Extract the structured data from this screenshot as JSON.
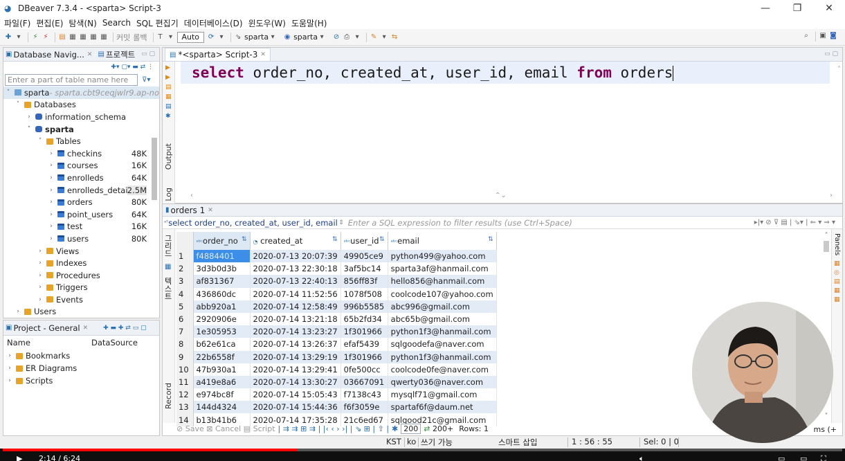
{
  "window": {
    "title": "DBeaver 7.3.4 - <sparta> Script-3",
    "controls": [
      "—",
      "❐",
      "✕"
    ]
  },
  "menu": [
    "파일(F)",
    "편집(E)",
    "탐색(N)",
    "Search",
    "SQL 편집기",
    "데이터베이스(D)",
    "윈도우(W)",
    "도움말(H)"
  ],
  "toolbar": {
    "commit_label": "커밋",
    "rollback_label": "롤백",
    "auto_label": "Auto",
    "datasource": "sparta",
    "schema": "sparta"
  },
  "navigator": {
    "tab_label": "Database Navig...",
    "tab2_label": "프로젝트",
    "filter_placeholder": "Enter a part of table name here",
    "connection": "sparta",
    "connection_host": " - sparta.cbt9ceqjwlr9.ap-no",
    "databases_label": "Databases",
    "info_schema": "information_schema",
    "db_name": "sparta",
    "tables_label": "Tables",
    "tables": [
      {
        "name": "checkins",
        "size": "48K"
      },
      {
        "name": "courses",
        "size": "16K"
      },
      {
        "name": "enrolleds",
        "size": "64K"
      },
      {
        "name": "enrolleds_detail",
        "size": "2.5M"
      },
      {
        "name": "orders",
        "size": "80K"
      },
      {
        "name": "point_users",
        "size": "64K"
      },
      {
        "name": "test",
        "size": "16K"
      },
      {
        "name": "users",
        "size": "80K"
      }
    ],
    "folders": [
      "Views",
      "Indexes",
      "Procedures",
      "Triggers",
      "Events"
    ],
    "users_label": "Users"
  },
  "project": {
    "tab_label": "Project - General",
    "col_name": "Name",
    "col_datasource": "DataSource",
    "items": [
      "Bookmarks",
      "ER Diagrams",
      "Scripts"
    ]
  },
  "editor": {
    "tab_label": "*<sparta> Script-3",
    "output_label": "Output",
    "log_label": "Log",
    "code": {
      "kw1": "select",
      "cols": " order_no, created_at, user_id, email ",
      "kw2": "from",
      "table": " orders"
    }
  },
  "results": {
    "tab_label": "orders 1",
    "query_text": "select order_no, created_at, user_id, email fro",
    "filter_placeholder": "Enter a SQL expression to filter results (use Ctrl+Space)",
    "headers": [
      "order_no",
      "created_at",
      "user_id",
      "email"
    ],
    "rows": [
      [
        "1",
        "f4884401",
        "2020-07-13 20:07:39",
        "49905ce9",
        "python499@yahoo.com"
      ],
      [
        "2",
        "3d3b0d3b",
        "2020-07-13 22:30:18",
        "3af5bc14",
        "sparta3af@hanmail.com"
      ],
      [
        "3",
        "af831367",
        "2020-07-13 22:40:13",
        "856ff83f",
        "hello856@hanmail.com"
      ],
      [
        "4",
        "436860dc",
        "2020-07-14 11:52:56",
        "1078f508",
        "coolcode107@yahoo.com"
      ],
      [
        "5",
        "abb920a1",
        "2020-07-14 12:58:49",
        "996b5585",
        "abc996@gmail.com"
      ],
      [
        "6",
        "2920906e",
        "2020-07-14 13:21:18",
        "65b2fd34",
        "abc65b@gmail.com"
      ],
      [
        "7",
        "1e305953",
        "2020-07-14 13:23:27",
        "1f301966",
        "python1f3@hanmail.com"
      ],
      [
        "8",
        "b62e61ca",
        "2020-07-14 13:26:37",
        "efaf5439",
        "sqlgoodefa@naver.com"
      ],
      [
        "9",
        "22b6558f",
        "2020-07-14 13:29:19",
        "1f301966",
        "python1f3@hanmail.com"
      ],
      [
        "10",
        "47b930a1",
        "2020-07-14 13:29:41",
        "0fe500cc",
        "coolcode0fe@naver.com"
      ],
      [
        "11",
        "a419e8a6",
        "2020-07-14 13:30:27",
        "03667091",
        "qwerty036@naver.com"
      ],
      [
        "12",
        "e974bc8f",
        "2020-07-14 15:05:43",
        "f7138c43",
        "mysqlf71@gmail.com"
      ],
      [
        "13",
        "144d4324",
        "2020-07-14 15:44:36",
        "f6f3059e",
        "spartaf6f@daum.net"
      ],
      [
        "14",
        "b13b41b6",
        "2020-07-14 17:35:28",
        "21c6ed67",
        "sqlgood21c@gmail.com"
      ]
    ],
    "side_grid_label": "그리드",
    "side_text_label": "텍스트",
    "record_label": "Record",
    "panels_label": "Panels",
    "footer": {
      "save": "Save",
      "cancel": "Cancel",
      "script": "Script",
      "limit": "200",
      "fetch": "200+",
      "rows": "Rows: 1",
      "items": "ms (+"
    }
  },
  "statusbar": {
    "tz": "KST",
    "lang": "ko",
    "mode": "쓰기 가능",
    "insert": "스마트 삽입",
    "pos": "1 : 56 : 55",
    "sel": "Sel: 0 | 0"
  },
  "video": {
    "time": "2:14 / 6:24",
    "progress": 0.35
  }
}
